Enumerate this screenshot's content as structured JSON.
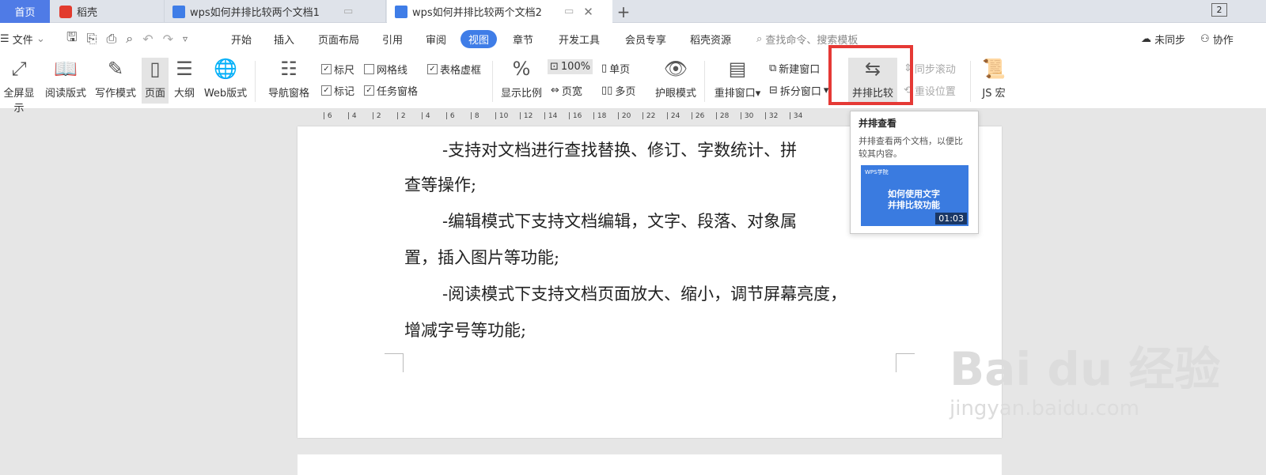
{
  "tabs": {
    "home": "首页",
    "daoke": "稻壳",
    "doc1": "wps如何并排比较两个文档1",
    "doc2": "wps如何并排比较两个文档2",
    "add": "+"
  },
  "window_count": "2",
  "menu": {
    "file": "文件",
    "items": [
      "开始",
      "插入",
      "页面布局",
      "引用",
      "审阅",
      "视图",
      "章节",
      "开发工具",
      "会员专享",
      "稻壳资源"
    ],
    "active": "视图",
    "search": "查找命令、搜索模板",
    "sync": "未同步",
    "collab": "协作"
  },
  "ribbon": {
    "fullscreen": "全屏显示",
    "reading": "阅读版式",
    "writing": "写作模式",
    "page": "页面",
    "outline": "大纲",
    "web": "Web版式",
    "nav": "导航窗格",
    "ruler": "标尺",
    "gridlines": "网格线",
    "table_virtual": "表格虚框",
    "marks": "标记",
    "task_pane": "任务窗格",
    "zoom": "显示比例",
    "zoom_pct": "100%",
    "single": "单页",
    "width": "页宽",
    "multi": "多页",
    "eye": "护眼模式",
    "rearrange": "重排窗口",
    "new_window": "新建窗口",
    "split": "拆分窗口",
    "side_by_side": "并排比较",
    "sync_scroll": "同步滚动",
    "reset_pos": "重设位置",
    "js": "JS 宏"
  },
  "ruler_ticks": [
    "6",
    "4",
    "2",
    "2",
    "4",
    "6",
    "8",
    "10",
    "12",
    "14",
    "16",
    "18",
    "20",
    "22",
    "24",
    "26",
    "28",
    "30",
    "32",
    "34"
  ],
  "tooltip": {
    "title": "并排查看",
    "desc": "并排查看两个文档，以便比较其内容。",
    "thumb_logo": "WPS学院",
    "thumb_text1": "如何使用文字",
    "thumb_text2": "并排比较功能",
    "duration": "01:03"
  },
  "doc_lines": [
    "-支持对文档进行查找替换、修订、字数统计、拼",
    "查等操作;",
    "-编辑模式下支持文档编辑，文字、段落、对象属",
    "置，插入图片等功能;",
    "-阅读模式下支持文档页面放大、缩小，调节屏幕亮度，",
    "增减字号等功能;"
  ],
  "watermark": {
    "brand": "Bai du 经验",
    "url": "jingyan.baidu.com"
  }
}
